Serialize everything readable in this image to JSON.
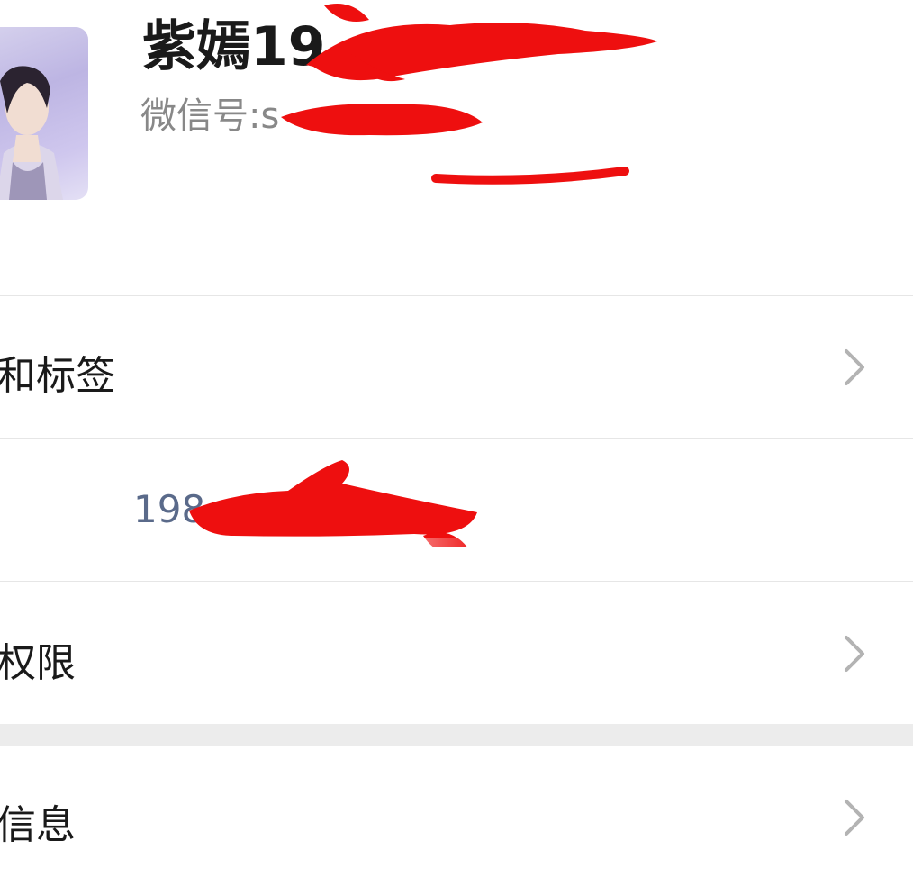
{
  "profile": {
    "name_visible": "紫嫣19",
    "wechat_id_label": "微信号:",
    "wechat_id_prefix": "s"
  },
  "rows": [
    {
      "label": "和标签",
      "chevron_icon": "chevron-right-icon"
    },
    {
      "phone_visible": "198"
    },
    {
      "label": "权限",
      "chevron_icon": "chevron-right-icon"
    },
    {
      "label": "信息",
      "chevron_icon": "chevron-right-icon"
    }
  ],
  "colors": {
    "redaction": "#ee0f0f",
    "divider": "#e6e6e6",
    "section_gap": "#ececec",
    "chevron": "#b3b3b3",
    "phone_text": "#5a6a8a"
  }
}
